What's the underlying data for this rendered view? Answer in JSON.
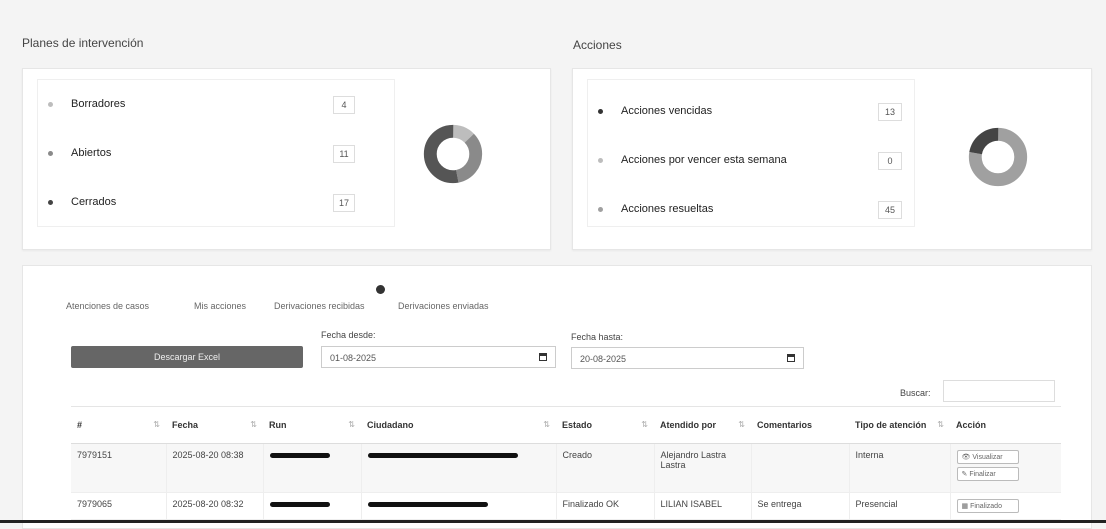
{
  "sections": {
    "plans_title": "Planes de intervención",
    "actions_title": "Acciones"
  },
  "plans": {
    "items": [
      {
        "label": "Borradores",
        "count": "4",
        "color": "#bdbdbd"
      },
      {
        "label": "Abiertos",
        "count": "11",
        "color": "#8a8a8a"
      },
      {
        "label": "Cerrados",
        "count": "17",
        "color": "#555555"
      }
    ]
  },
  "actions": {
    "items": [
      {
        "label": "Acciones vencidas",
        "count": "13",
        "color": "#444444"
      },
      {
        "label": "Acciones por vencer esta semana",
        "count": "0",
        "color": "#bdbdbd"
      },
      {
        "label": "Acciones resueltas",
        "count": "45",
        "color": "#a0a0a0"
      }
    ]
  },
  "tabs": [
    "Atenciones de casos",
    "Mis acciones",
    "Derivaciones recibidas",
    "Derivaciones enviadas"
  ],
  "filters": {
    "excel_button": "Descargar Excel",
    "from_label": "Fecha desde:",
    "from_value": "01-08-2025",
    "to_label": "Fecha hasta:",
    "to_value": "20-08-2025",
    "search_label": "Buscar:"
  },
  "table": {
    "headers": [
      "#",
      "Fecha",
      "Run",
      "Ciudadano",
      "Estado",
      "Atendido por",
      "Comentarios",
      "Tipo de atención",
      "Acción"
    ],
    "rows": [
      {
        "id": "7979151",
        "fecha": "2025-08-20 08:38",
        "estado": "Creado",
        "atendido": "Alejandro Lastra Lastra",
        "comentarios": "",
        "tipo": "Interna",
        "actions": [
          "Visualizar",
          "Finalizar"
        ]
      },
      {
        "id": "7979065",
        "fecha": "2025-08-20 08:32",
        "estado": "Finalizado OK",
        "atendido": "LILIAN ISABEL",
        "comentarios": "Se entrega",
        "tipo": "Presencial",
        "actions": [
          "Finalizado"
        ]
      }
    ]
  }
}
